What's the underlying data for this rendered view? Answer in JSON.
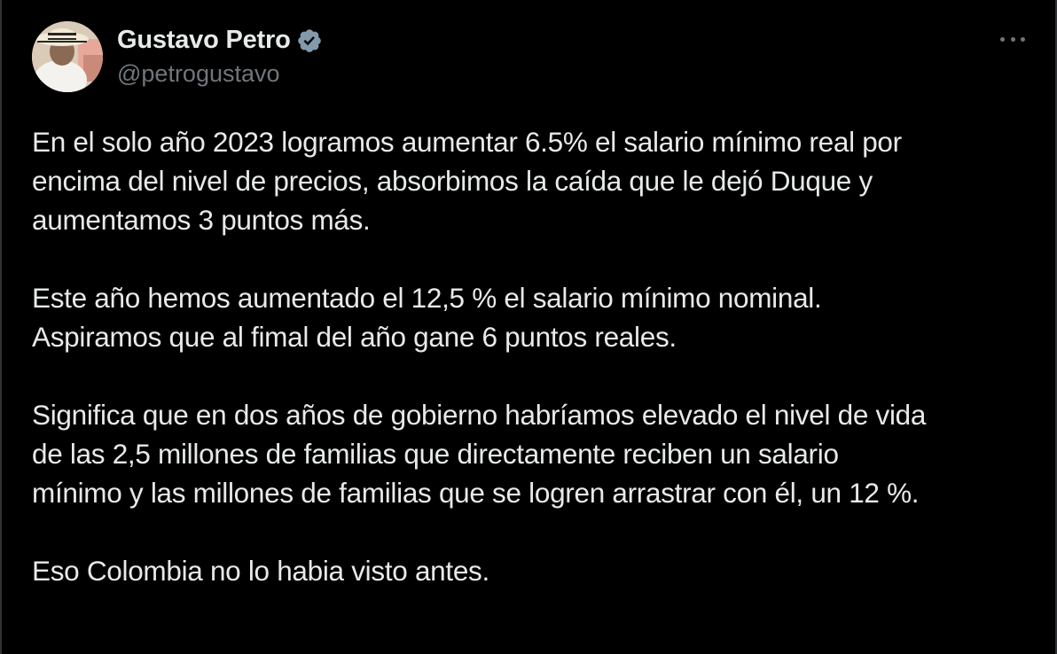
{
  "tweet": {
    "author": {
      "display_name": "Gustavo Petro",
      "handle": "@petrogustavo",
      "verified": true,
      "avatar_icon": "profile-avatar"
    },
    "more_icon": "more-options-icon",
    "paragraphs": [
      "En el solo año 2023 logramos aumentar 6.5% el salario mínimo real por\nencima del nivel de precios, absorbimos la caída que le dejó Duque y\naumentamos 3 puntos más.",
      "Este año hemos aumentado el 12,5 % el salario mínimo nominal.\nAspiramos que al fimal del año gane 6 puntos reales.",
      "Significa que en dos años de gobierno habríamos elevado el nivel de vida\nde las 2,5 millones de familias que directamente reciben un salario\nmínimo y las millones de familias que se logren arrastrar con él, un 12 %.",
      "Eso Colombia no lo habia visto antes."
    ]
  },
  "colors": {
    "background": "#000000",
    "text_primary": "#e7e9ea",
    "text_secondary": "#71767b",
    "verified_badge": "#829aab"
  }
}
